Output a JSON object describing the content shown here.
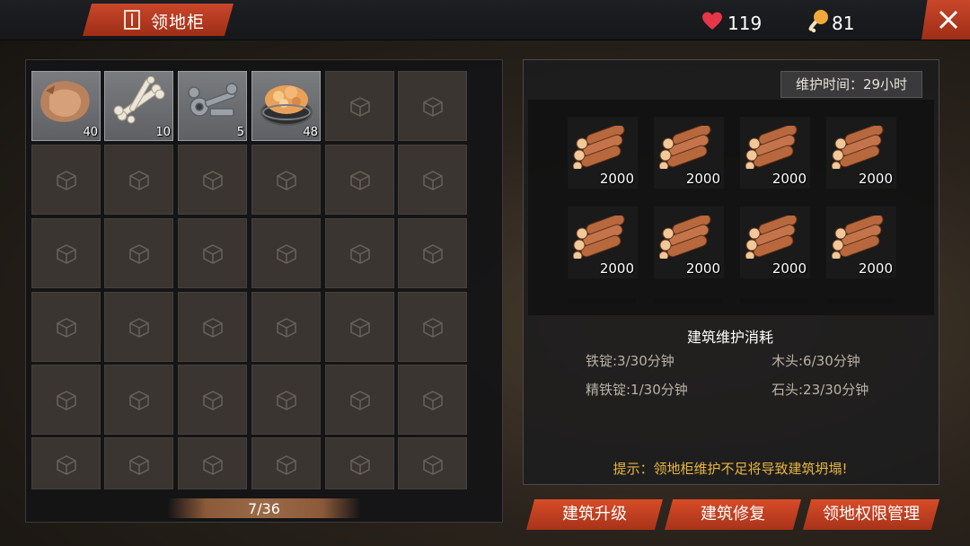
{
  "header": {
    "title": "领地柜",
    "health": "119",
    "food": "81"
  },
  "inventory": {
    "capacity_text": "7/36",
    "items": [
      {
        "icon": "hide-icon",
        "qty": "40"
      },
      {
        "icon": "bones-icon",
        "qty": "10"
      },
      {
        "icon": "metal-parts-icon",
        "qty": "5"
      },
      {
        "icon": "food-bowl-icon",
        "qty": "48"
      }
    ]
  },
  "maintenance": {
    "time_label": "维护时间：29小时",
    "wood_slots": [
      {
        "icon": "wood-logs-icon",
        "qty": "2000"
      },
      {
        "icon": "wood-logs-icon",
        "qty": "2000"
      },
      {
        "icon": "wood-logs-icon",
        "qty": "2000"
      },
      {
        "icon": "wood-logs-icon",
        "qty": "2000"
      },
      {
        "icon": "wood-logs-icon",
        "qty": "2000"
      },
      {
        "icon": "wood-logs-icon",
        "qty": "2000"
      },
      {
        "icon": "wood-logs-icon",
        "qty": "2000"
      },
      {
        "icon": "wood-logs-icon",
        "qty": "2000"
      }
    ],
    "section_title": "建筑维护消耗",
    "costs": {
      "iron_ingot": "铁锭:3/30分钟",
      "wood": "木头:6/30分钟",
      "refined_iron": "精铁锭:1/30分钟",
      "stone": "石头:23/30分钟"
    },
    "hint": "提示：领地柜维护不足将导致建筑坍塌!"
  },
  "buttons": {
    "upgrade": "建筑升级",
    "repair": "建筑修复",
    "permissions": "领地权限管理"
  },
  "colors": {
    "accent": "#c9462a",
    "hint": "#e8b640"
  }
}
